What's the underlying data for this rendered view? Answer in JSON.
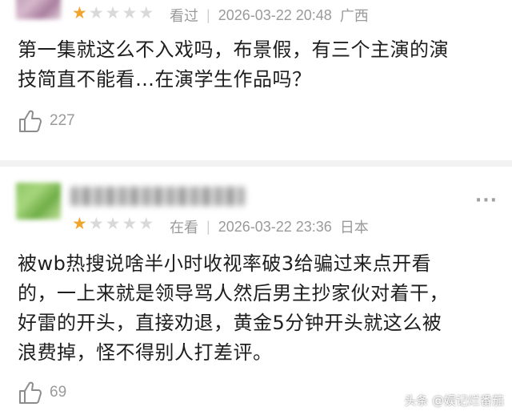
{
  "reviews": [
    {
      "rating": 1,
      "status": "看过",
      "datetime": "2026-03-22 20:48",
      "location": "广西",
      "text_lines": [
        "第一集就这么不入戏吗，布景假，有三个主演的演",
        "技简直不能看…在演学生作品吗？"
      ],
      "likes": "227"
    },
    {
      "rating": 1,
      "status": "在看",
      "datetime": "2026-03-22 23:36",
      "location": "日本",
      "more": "···",
      "text_lines": [
        "被wb热搜说啥半小时收视率破3给骗过来点开看",
        "的，一上来就是领导骂人然后男主抄家伙对着干，",
        "好雷的开头，直接劝退，黄金5分钟开头就这么被",
        "浪费掉，怪不得别人打差评。"
      ],
      "likes": "69"
    }
  ],
  "icons": {
    "star": "star-icon",
    "like": "thumbs-up-icon",
    "more": "more-icon"
  },
  "colors": {
    "star_on": "#f0a62c",
    "star_off": "#d9d9d9",
    "meta": "#9a9a9a"
  },
  "watermark": "头条 @娱记烂番茄"
}
